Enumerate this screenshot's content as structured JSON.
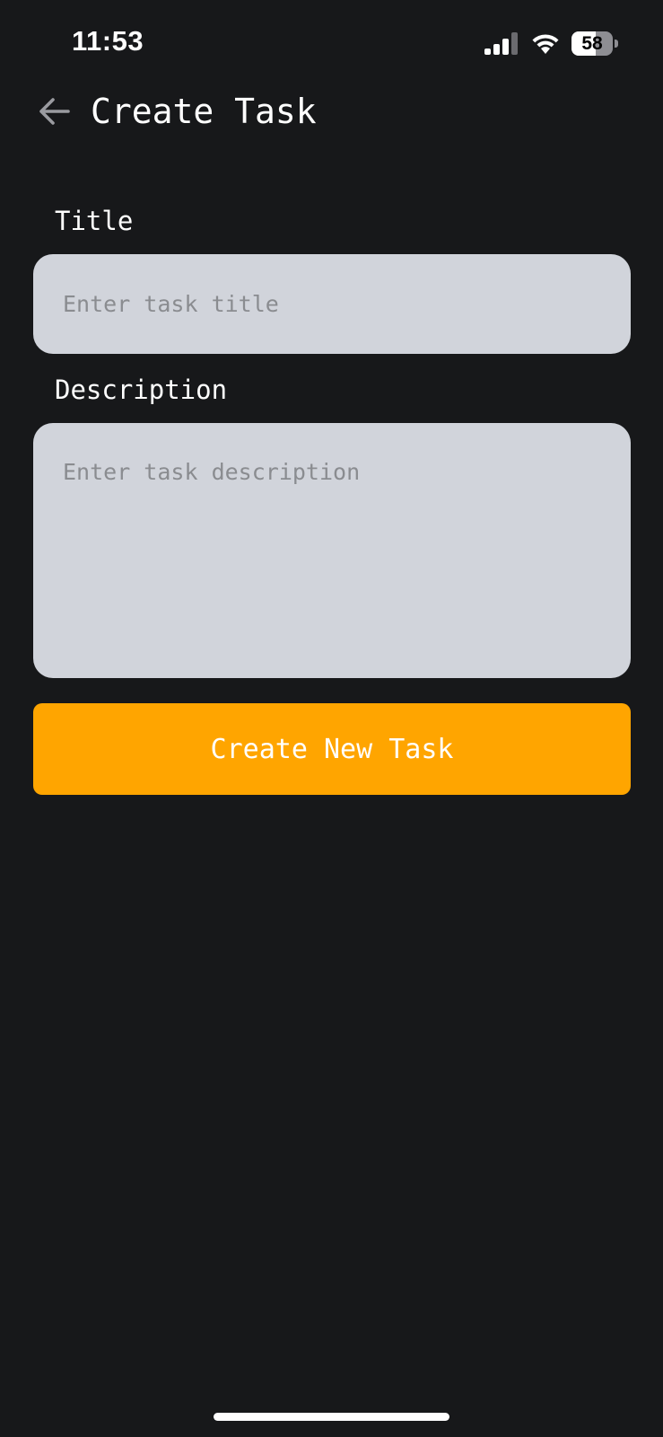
{
  "status_bar": {
    "time": "11:53",
    "battery_percent": "58",
    "battery_level": 0.58,
    "icons": [
      "cellular-signal-icon",
      "wifi-icon",
      "battery-icon"
    ]
  },
  "header": {
    "back_icon": "arrow-left-icon",
    "title": "Create Task"
  },
  "form": {
    "title_label": "Title",
    "title_placeholder": "Enter task title",
    "title_value": "",
    "description_label": "Description",
    "description_placeholder": "Enter task description",
    "description_value": "",
    "submit_label": "Create New Task"
  },
  "colors": {
    "background": "#17181a",
    "input_background": "#d1d4db",
    "placeholder": "#8a8c90",
    "accent": "#ffa500",
    "text": "#ffffff"
  }
}
